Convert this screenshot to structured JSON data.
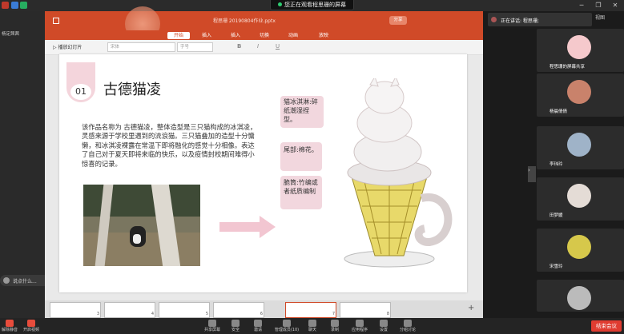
{
  "screen_share_banner": "您正在观看程思珊的屏幕",
  "window_controls": {
    "minimize": "─",
    "restore": "❐",
    "close": "✕"
  },
  "left_panel": {
    "user_label": "杨定茜茜",
    "chat_placeholder": "说点什么..."
  },
  "ppt": {
    "file_title": "程思珊 20190804作业.pptx",
    "ribbon_tabs": [
      "开始",
      "插入",
      "插入",
      "切换",
      "动画",
      "放映"
    ],
    "active_tab": "开始",
    "share_btn": "分享",
    "slideshow_btn": "播放幻灯片",
    "font_box": "宋体",
    "size_box": "字号"
  },
  "slide": {
    "number": "01",
    "title": "古德猫凌",
    "paragraph": "该作品名称为 古德猫凌，整体造型是三只猫构成的冰淇凌，灵感来源于学校里遇到的流浪猫。三只猫叠加的造型十分慵懒，和冰淇凌裸露在常温下即将融化的感觉十分相像。表达了自己对于夏天即将来临的快乐，以及疫情封校期间难得小惊喜的记录。",
    "callout_1": "猫冰淇淋:碎纸潮湿捏型。",
    "callout_2": "尾部:棉花。",
    "callout_3": "脆筒:竹编或者纸质编制"
  },
  "thumbnails": [
    {
      "num": "3"
    },
    {
      "num": "4"
    },
    {
      "num": "5"
    },
    {
      "num": "6"
    },
    {
      "num": "7"
    },
    {
      "num": "8"
    }
  ],
  "right_panel": {
    "speaking": "正在讲话: 程思珊;",
    "view_btn": "视图",
    "participants": [
      {
        "name": "程思珊的屏幕共享"
      },
      {
        "name": "杨晨倩倩"
      },
      {
        "name": "李玮玲"
      },
      {
        "name": "田梦媛"
      },
      {
        "name": "宋雪玲"
      },
      {
        "name": ""
      }
    ]
  },
  "bottom_bar": {
    "items": [
      "解除静音",
      "开启视频",
      "共享屏幕",
      "安全",
      "邀请",
      "管理成员(10)",
      "聊天",
      "录制",
      "应用程序",
      "设置",
      "分组讨论",
      "会议"
    ],
    "end_btn": "结束会议"
  },
  "colors": {
    "accent": "#d04a28",
    "end_btn": "#e03c31",
    "callout_bg": "#f2d7de",
    "title_pink": "#f4d5dc"
  }
}
